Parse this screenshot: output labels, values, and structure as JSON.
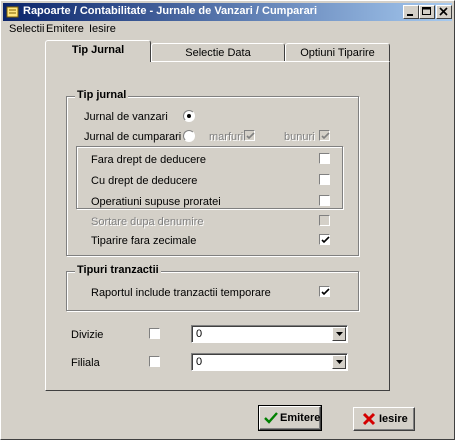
{
  "window": {
    "title": "Rapoarte / Contabilitate - Jurnale de Vanzari / Cumparari"
  },
  "menu": [
    "Selectii",
    "Emitere",
    "Iesire"
  ],
  "tabs": [
    {
      "label": "Tip Jurnal",
      "active": true
    },
    {
      "label": "Selectie Data",
      "active": false
    },
    {
      "label": "Optiuni Tiparire",
      "active": false
    }
  ],
  "tip_jurnal": {
    "title": "Tip jurnal",
    "vanzari": {
      "label": "Jurnal de vanzari",
      "selected": true
    },
    "cumparari": {
      "label": "Jurnal de cumparari",
      "selected": false
    },
    "marfuri": {
      "label": "marfuri",
      "checked": true,
      "enabled": false
    },
    "bunuri": {
      "label": "bunuri",
      "checked": true,
      "enabled": false
    },
    "fara_drept": {
      "label": "Fara drept de deducere",
      "checked": false
    },
    "cu_drept": {
      "label": "Cu drept de deducere",
      "checked": false
    },
    "proratei": {
      "label": "Operatiuni supuse proratei",
      "checked": false
    },
    "sortare": {
      "label": "Sortare dupa denumire",
      "checked": false,
      "enabled": false
    },
    "zecimale": {
      "label": "Tiparire  fara zecimale",
      "checked": true
    }
  },
  "tipuri_tranzactii": {
    "title": "Tipuri tranzactii",
    "temporare": {
      "label": "Raportul include tranzactii temporare",
      "checked": true
    }
  },
  "divizie": {
    "label": "Divizie",
    "checked": false,
    "value": "0"
  },
  "filiala": {
    "label": "Filiala",
    "checked": false,
    "value": "0"
  },
  "buttons": {
    "emitere": "Emitere",
    "iesire": "Iesire"
  },
  "colors": {
    "title_start": "#0a246a",
    "title_end": "#a6caf0",
    "face": "#d4d0c8",
    "cancel_x": "#d40000",
    "ok_check": "#008000"
  }
}
